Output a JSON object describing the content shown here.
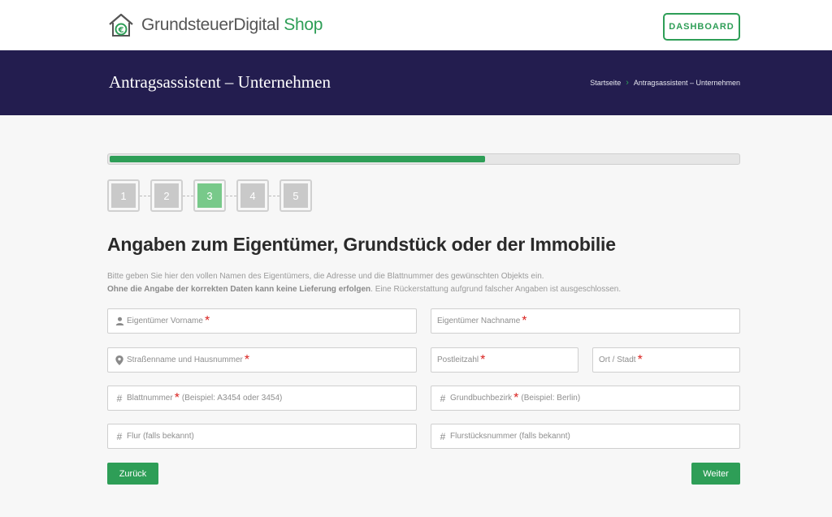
{
  "header": {
    "logo_main": "GrundsteuerDigital",
    "logo_accent": "Shop",
    "dashboard_label": "DASHBOARD"
  },
  "hero": {
    "title": "Antragsassistent – Unternehmen",
    "breadcrumb": [
      "Startseite",
      "Antragsassistent – Unternehmen"
    ]
  },
  "progress": {
    "fraction": 0.6
  },
  "steps": {
    "labels": [
      "1",
      "2",
      "3",
      "4",
      "5"
    ],
    "active": "3"
  },
  "form": {
    "title": "Angaben zum Eigentümer, Grundstück oder der Immobilie",
    "intro_line1": "Bitte geben Sie hier den vollen Namen des Eigentümers, die Adresse und die Blattnummer des gewünschten Objekts ein.",
    "intro_bold": "Ohne die Angabe der korrekten Daten kann keine Lieferung erfolgen",
    "intro_rest": ". Eine Rückerstattung aufgrund falscher Angaben ist ausgeschlossen.",
    "fields": {
      "first_name": {
        "placeholder": "Eigentümer Vorname",
        "required": "*",
        "icon": "user-icon"
      },
      "last_name": {
        "placeholder": "Eigentümer Nachname",
        "required": "*"
      },
      "street": {
        "placeholder": "Straßenname und Hausnummer",
        "required": "*",
        "icon": "location-pin-icon"
      },
      "zip": {
        "placeholder": "Postleitzahl",
        "required": "*"
      },
      "city": {
        "placeholder": "Ort / Stadt",
        "required": "*"
      },
      "sheet_number": {
        "placeholder": "Blattnummer",
        "required": "*",
        "hint": "(Beispiel: A3454 oder 3454)",
        "icon": "hash-icon"
      },
      "land_registry_district": {
        "placeholder": "Grundbuchbezirk",
        "required": "*",
        "hint": "(Beispiel: Berlin)",
        "icon": "hash-icon"
      },
      "flur": {
        "placeholder": "Flur (falls bekannt)",
        "icon": "hash-icon"
      },
      "parcel_number": {
        "placeholder": "Flurstücksnummer (falls bekannt)",
        "icon": "hash-icon"
      }
    },
    "back_label": "Zurück",
    "next_label": "Weiter"
  },
  "colors": {
    "brand_green": "#2e9e57",
    "hero_navy": "#231d4f",
    "active_step": "#78c98a",
    "required_red": "#d9221f"
  }
}
